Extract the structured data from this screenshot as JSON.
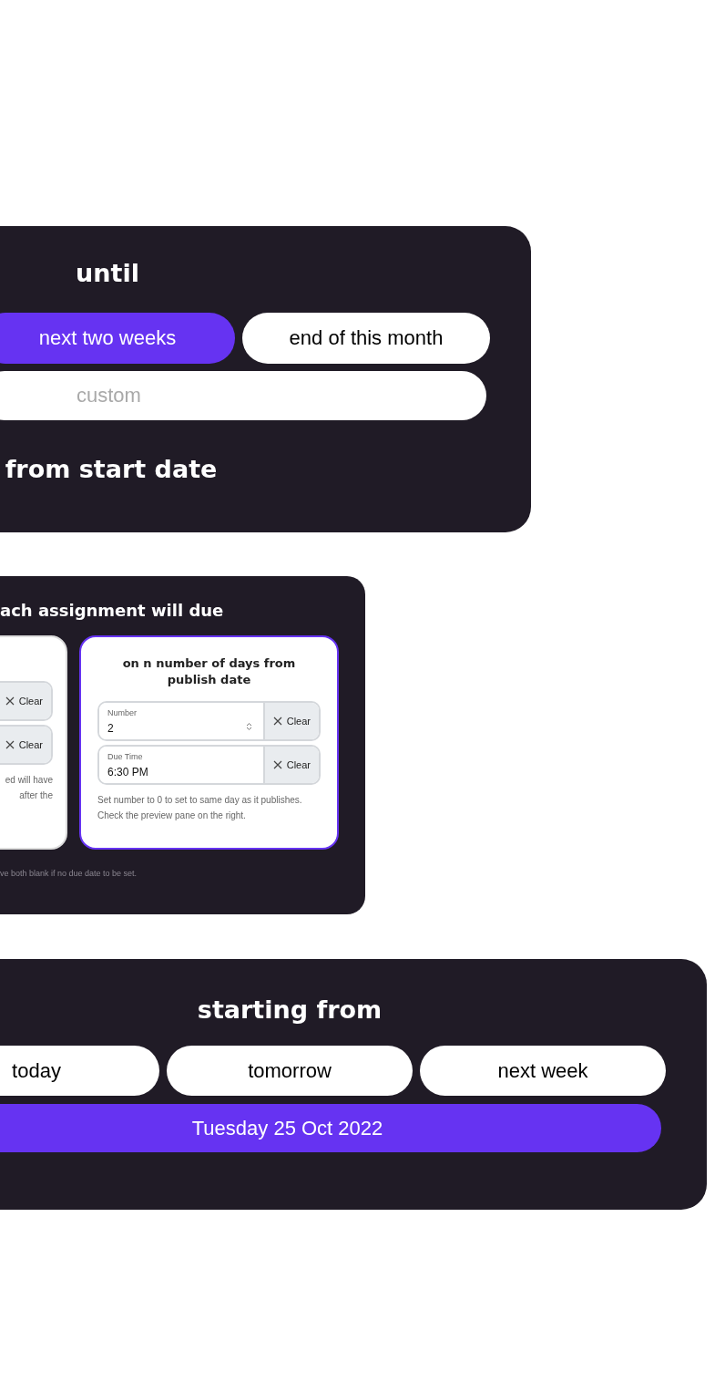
{
  "until_panel": {
    "heading": "until",
    "options": [
      {
        "label": "next two weeks",
        "selected": true
      },
      {
        "label": "end of this month",
        "selected": false
      }
    ],
    "custom_field": {
      "placeholder": "custom"
    },
    "footer_heading": "from start date"
  },
  "due_panel": {
    "heading": "ach assignment will due",
    "left_card": {
      "clear_buttons": [
        "Clear",
        "Clear"
      ],
      "note_lines": [
        "ed will have",
        "after the"
      ]
    },
    "right_card": {
      "title": "on n number of days from publish date",
      "selected": true,
      "fields": [
        {
          "kind": "number",
          "label": "Number",
          "value": "2",
          "clear": "Clear"
        },
        {
          "kind": "time",
          "label": "Due Time",
          "value": "6:30 PM",
          "clear": "Clear"
        }
      ],
      "note": "Set number to 0 to set to same day as it publishes. Check the preview pane on the right."
    },
    "footer": "ve both blank if no due date to be set."
  },
  "start_panel": {
    "heading": "starting from",
    "options": [
      {
        "label": "today",
        "selected": false
      },
      {
        "label": "tomorrow",
        "selected": false
      },
      {
        "label": "next week",
        "selected": false
      },
      {
        "label": "Tuesday 25 Oct 2022",
        "selected": true
      }
    ]
  }
}
